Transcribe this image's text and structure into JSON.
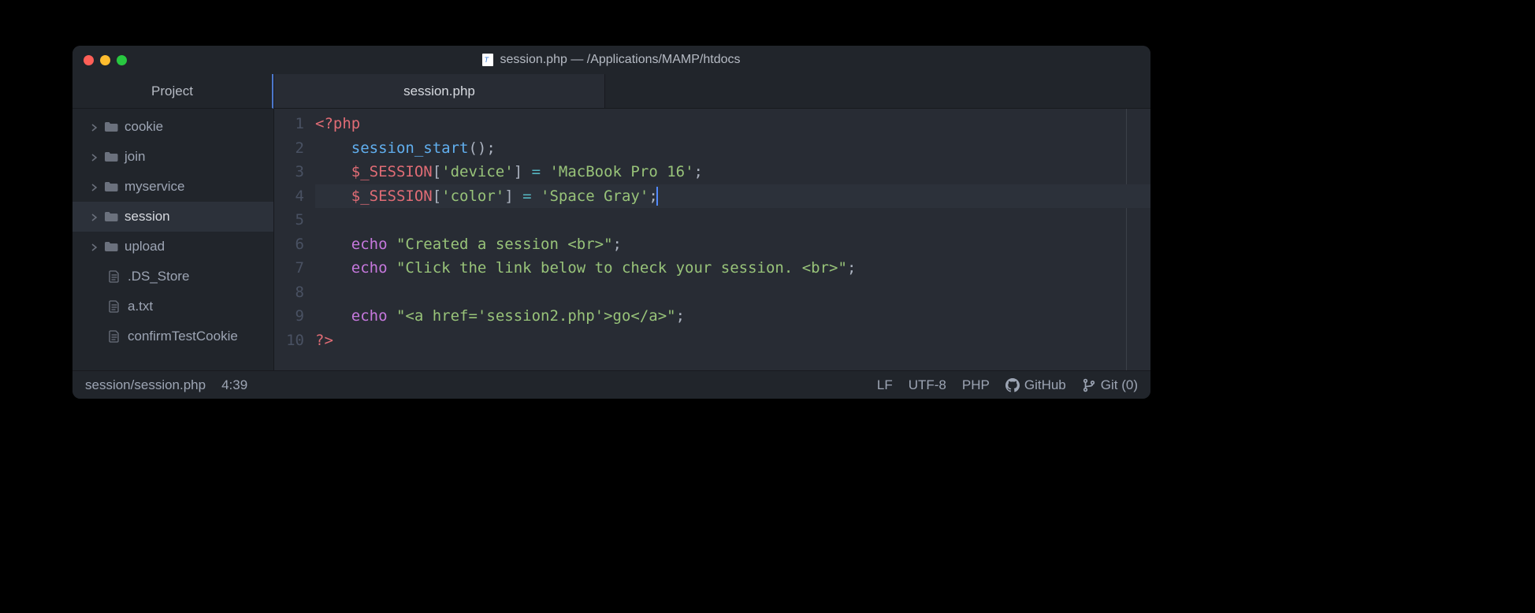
{
  "window": {
    "title": "session.php — /Applications/MAMP/htdocs"
  },
  "sidebar": {
    "header": "Project",
    "items": [
      {
        "type": "folder",
        "label": "cookie",
        "selected": false
      },
      {
        "type": "folder",
        "label": "join",
        "selected": false
      },
      {
        "type": "folder",
        "label": "myservice",
        "selected": false
      },
      {
        "type": "folder",
        "label": "session",
        "selected": true
      },
      {
        "type": "folder",
        "label": "upload",
        "selected": false
      },
      {
        "type": "file",
        "label": ".DS_Store",
        "selected": false
      },
      {
        "type": "file",
        "label": "a.txt",
        "selected": false
      },
      {
        "type": "file",
        "label": "confirmTestCookie",
        "selected": false
      }
    ]
  },
  "tabs": {
    "active": "session.php"
  },
  "editor": {
    "line_numbers": [
      "1",
      "2",
      "3",
      "4",
      "5",
      "6",
      "7",
      "8",
      "9",
      "10"
    ],
    "current_line": 4,
    "lines": [
      [
        {
          "c": "tag",
          "t": "<?php"
        }
      ],
      [
        {
          "c": "default",
          "t": "    "
        },
        {
          "c": "func",
          "t": "session_start"
        },
        {
          "c": "punc",
          "t": "();"
        }
      ],
      [
        {
          "c": "default",
          "t": "    "
        },
        {
          "c": "var",
          "t": "$_SESSION"
        },
        {
          "c": "punc",
          "t": "["
        },
        {
          "c": "str",
          "t": "'device'"
        },
        {
          "c": "punc",
          "t": "] "
        },
        {
          "c": "op",
          "t": "="
        },
        {
          "c": "punc",
          "t": " "
        },
        {
          "c": "str",
          "t": "'MacBook Pro 16'"
        },
        {
          "c": "punc",
          "t": ";"
        }
      ],
      [
        {
          "c": "default",
          "t": "    "
        },
        {
          "c": "var",
          "t": "$_SESSION"
        },
        {
          "c": "punc",
          "t": "["
        },
        {
          "c": "str",
          "t": "'color'"
        },
        {
          "c": "punc",
          "t": "] "
        },
        {
          "c": "op",
          "t": "="
        },
        {
          "c": "punc",
          "t": " "
        },
        {
          "c": "str",
          "t": "'Space Gray'"
        },
        {
          "c": "punc",
          "t": ";"
        }
      ],
      [],
      [
        {
          "c": "default",
          "t": "    "
        },
        {
          "c": "echo",
          "t": "echo"
        },
        {
          "c": "punc",
          "t": " "
        },
        {
          "c": "str",
          "t": "\"Created a session <br>\""
        },
        {
          "c": "punc",
          "t": ";"
        }
      ],
      [
        {
          "c": "default",
          "t": "    "
        },
        {
          "c": "echo",
          "t": "echo"
        },
        {
          "c": "punc",
          "t": " "
        },
        {
          "c": "str",
          "t": "\"Click the link below to check your session. <br>\""
        },
        {
          "c": "punc",
          "t": ";"
        }
      ],
      [],
      [
        {
          "c": "default",
          "t": "    "
        },
        {
          "c": "echo",
          "t": "echo"
        },
        {
          "c": "punc",
          "t": " "
        },
        {
          "c": "str",
          "t": "\"<a href='session2.php'>go</a>\""
        },
        {
          "c": "punc",
          "t": ";"
        }
      ],
      [
        {
          "c": "tag",
          "t": "?>"
        }
      ]
    ]
  },
  "statusbar": {
    "path": "session/session.php",
    "cursor": "4:39",
    "line_ending": "LF",
    "encoding": "UTF-8",
    "language": "PHP",
    "github": "GitHub",
    "git": "Git (0)"
  }
}
